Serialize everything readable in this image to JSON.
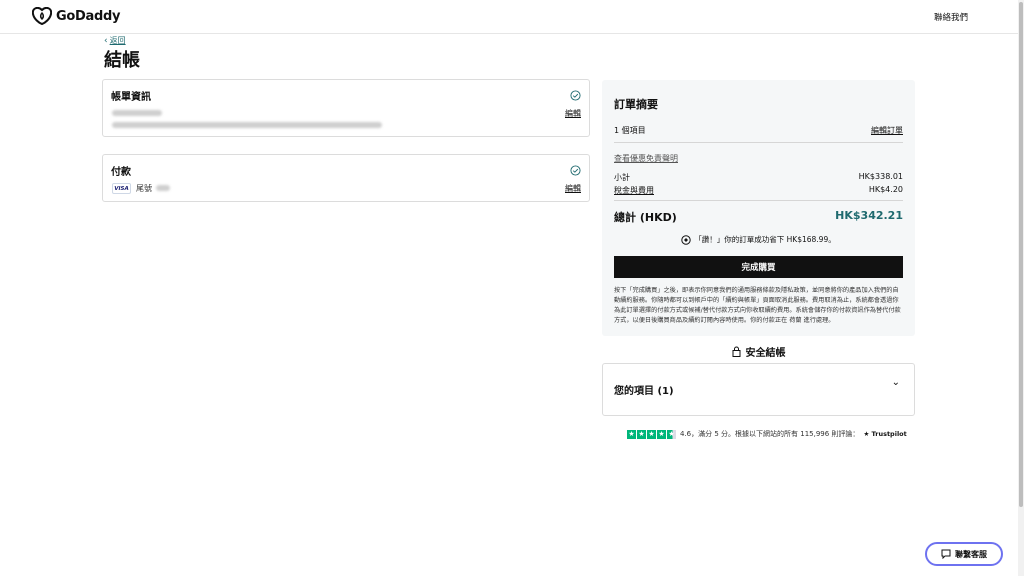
{
  "header": {
    "brand": "GoDaddy",
    "contact_label": "聯絡我們"
  },
  "nav": {
    "back_label": "返回"
  },
  "page": {
    "title": "結帳"
  },
  "billing": {
    "title": "帳單資訊",
    "edit_label": "編輯"
  },
  "payment": {
    "title": "付款",
    "card_brand": "VISA",
    "card_suffix_label": "尾號"
  },
  "summary": {
    "title": "訂單摘要",
    "item_count": "1 個項目",
    "edit_order_label": "編輯訂單",
    "disclaimer_link": "查看優惠免責聲明",
    "subtotal_label": "小計",
    "subtotal_value": "HK$338.01",
    "tax_label": "稅金與費用",
    "tax_value": "HK$4.20",
    "total_label": "總計 (HKD)",
    "total_value": "HK$342.21",
    "reward_text": "「讚！」你的訂單成功省下 HK$168.99。",
    "complete_button": "完成購買",
    "legal_text": "按下「完成購買」之後，即表示你同意我們的通用服務條款及隱私政策，並同意將你的產品加入我們的自動續約服務。你隨時都可以到帳戶中的「續約與帳單」頁面取消此服務。費用取消為止，系統都會透過你為此訂單選擇的付款方式或候補/替代付款方式向你收取續約費用。系統會儲存你的付款資訊作為替代付款方式，以便日後購買商品及續約訂閱內容時使用。你的付款正在 荷蘭 進行處理。"
  },
  "secure": {
    "label": "安全結帳"
  },
  "items": {
    "title": "您的項目 (1)"
  },
  "rating": {
    "score_text": "4.6，滿分 5 分。根據以下網站的所有 115,996 則評論：",
    "source": "Trustpilot",
    "stars": 4.6
  },
  "chat": {
    "label": "聯繫客服"
  },
  "colors": {
    "accent": "#1f6a6f",
    "primary_button": "#111111",
    "trustpilot": "#00b67a",
    "chat_border": "#6e72f0"
  }
}
